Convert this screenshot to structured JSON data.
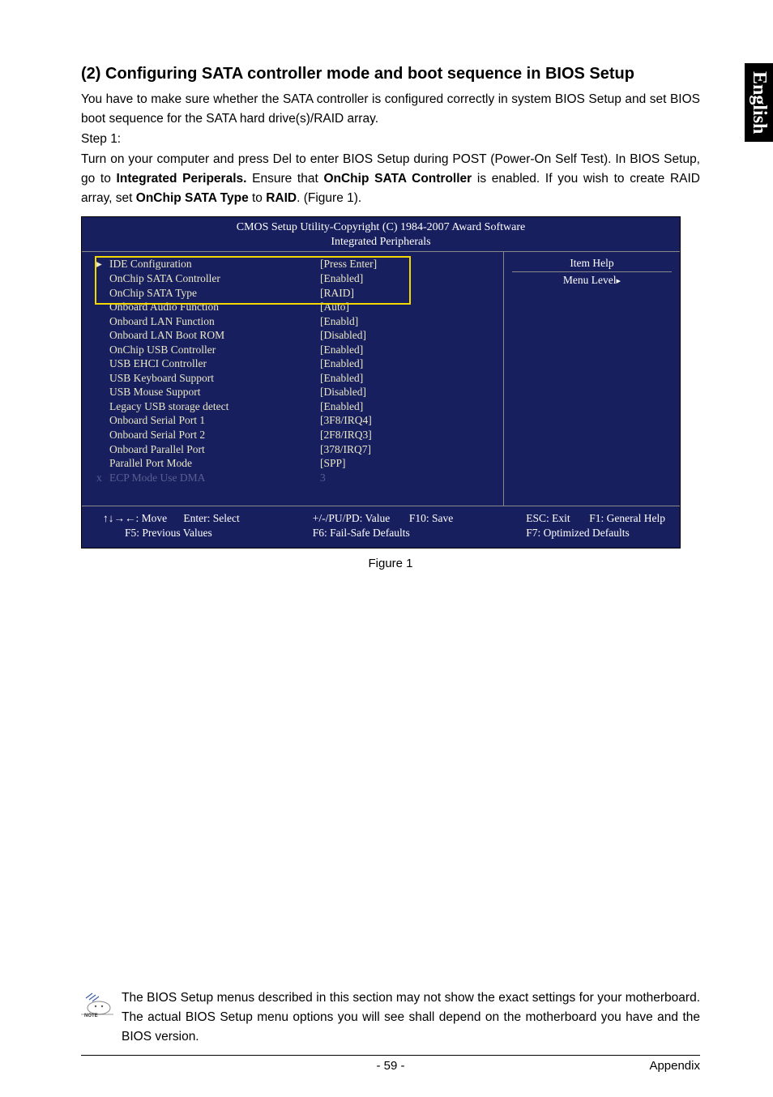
{
  "side_tab": "English",
  "heading": "(2) Configuring SATA controller mode and boot sequence in BIOS Setup",
  "intro_1": "You have to make sure whether the SATA controller is configured correctly in system BIOS Setup and set BIOS boot sequence for the SATA hard drive(s)/RAID array.",
  "step1_label": "Step 1:",
  "intro_2a": "Turn on your computer and press Del to enter BIOS Setup during POST (Power-On Self Test). In BIOS Setup, go to ",
  "intro_2b_bold": "Integrated Periperals.",
  "intro_2c": " Ensure that ",
  "intro_2d_bold": "OnChip SATA Controller",
  "intro_2e": " is enabled.  If you wish to create RAID array, set ",
  "intro_2f_bold": "OnChip SATA Type",
  "intro_2g": " to ",
  "intro_2h_bold": "RAID",
  "intro_2i": ". (Figure 1).",
  "bios_title_line1": "CMOS Setup Utility-Copyright (C) 1984-2007 Award Software",
  "bios_title_line2": "Integrated Peripherals",
  "bios_help_title": "Item Help",
  "bios_help_menu": "Menu Level",
  "bios_rows": [
    {
      "marker": "▸",
      "label": "IDE Configuration",
      "value": "[Press Enter]",
      "dim": false
    },
    {
      "marker": "",
      "label": "OnChip SATA Controller",
      "value": "[Enabled]",
      "dim": false
    },
    {
      "marker": "",
      "label": "OnChip SATA Type",
      "value": "[RAID]",
      "dim": false
    },
    {
      "marker": "",
      "label": "Onboard Audio Function",
      "value": "[Auto]",
      "dim": false
    },
    {
      "marker": "",
      "label": "Onboard LAN Function",
      "value": "[Enabld]",
      "dim": false
    },
    {
      "marker": "",
      "label": "Onboard LAN Boot ROM",
      "value": "[Disabled]",
      "dim": false
    },
    {
      "marker": "",
      "label": "OnChip USB Controller",
      "value": "[Enabled]",
      "dim": false
    },
    {
      "marker": "",
      "label": "USB EHCI Controller",
      "value": "[Enabled]",
      "dim": false
    },
    {
      "marker": "",
      "label": "USB Keyboard Support",
      "value": "[Enabled]",
      "dim": false
    },
    {
      "marker": "",
      "label": "USB Mouse Support",
      "value": "[Disabled]",
      "dim": false
    },
    {
      "marker": "",
      "label": "Legacy USB storage detect",
      "value": "[Enabled]",
      "dim": false
    },
    {
      "marker": "",
      "label": "Onboard Serial Port 1",
      "value": "[3F8/IRQ4]",
      "dim": false
    },
    {
      "marker": "",
      "label": "Onboard Serial Port 2",
      "value": "[2F8/IRQ3]",
      "dim": false
    },
    {
      "marker": "",
      "label": "Onboard Parallel Port",
      "value": "[378/IRQ7]",
      "dim": false
    },
    {
      "marker": "",
      "label": "Parallel Port Mode",
      "value": "[SPP]",
      "dim": false
    },
    {
      "marker": "x",
      "label": "ECP Mode Use DMA",
      "value": "3",
      "dim": true
    }
  ],
  "bios_footer_col1a": "↑↓→←: Move      Enter: Select",
  "bios_footer_col1b": "        F5: Previous Values",
  "bios_footer_col2a": "+/-/PU/PD: Value       F10: Save",
  "bios_footer_col2b": "F6: Fail-Safe Defaults",
  "bios_footer_col3a": "ESC: Exit       F1: General Help",
  "bios_footer_col3b": "F7: Optimized Defaults",
  "figure_label": "Figure 1",
  "note_text": "The BIOS Setup menus described in this section may not show the exact settings for your motherboard. The actual BIOS Setup menu options you will see shall depend on the motherboard you have and the BIOS version.",
  "page_number": "- 59 -",
  "appendix_label": "Appendix"
}
